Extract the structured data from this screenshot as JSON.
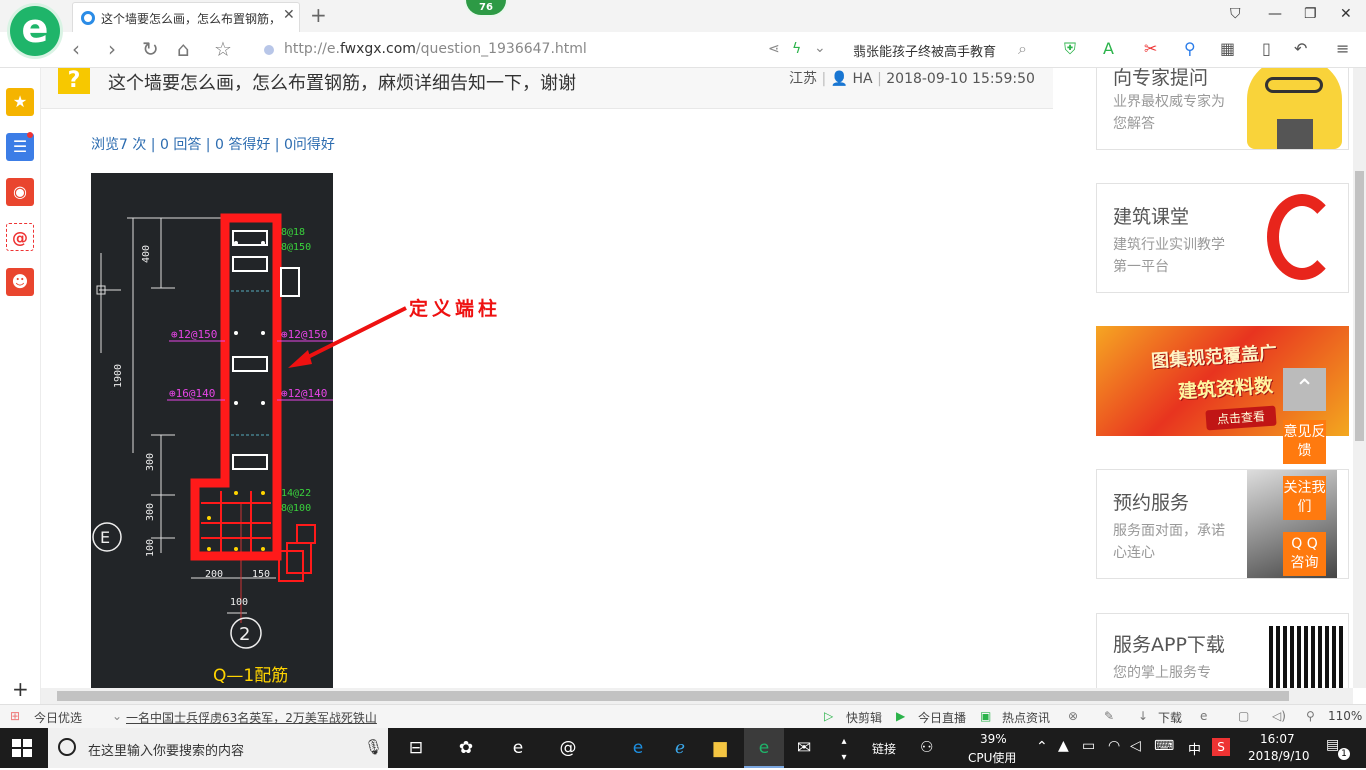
{
  "browser": {
    "tab_title": "这个墙要怎么画，怎么布置钢筋，",
    "badge": "76",
    "url_prefix": "http://e.",
    "url_domain": "fwxgx.com",
    "url_path": "/question_1936647.html",
    "search_text": "翡张能孩子终被高手教育"
  },
  "question": {
    "title": "这个墙要怎么画，怎么布置钢筋，麻烦详细告知一下，谢谢",
    "location": "江苏",
    "user": "HA",
    "datetime": "2018-09-10 15:59:50",
    "stats": {
      "views": "浏览7 次",
      "answers": "0 回答",
      "good_answers": "0 答得好",
      "good_questions": "0问得好"
    },
    "annotation": "定义端柱"
  },
  "cad": {
    "dims_left": [
      "400",
      "1900",
      "300",
      "300",
      "100"
    ],
    "dims_bottom": [
      "200",
      "150",
      "100"
    ],
    "rebar_labels": [
      "8@18",
      "8@150",
      "⊕12@150",
      "⊕12@150",
      "⊕16@140",
      "⊕12@140",
      "14@22",
      "8@100"
    ],
    "axis_e": "E",
    "axis_2": "2",
    "caption": "Q—1配筋"
  },
  "sidebar_right": {
    "expert": {
      "title": "向专家提问",
      "sub": "业界最权威专家为您解答"
    },
    "classroom": {
      "title": "建筑课堂",
      "sub": "建筑行业实训教学第一平台"
    },
    "promo": {
      "line1": "图集规范覆盖广",
      "line2": "建筑资料数",
      "cta": "点击查看"
    },
    "booking": {
      "title": "预约服务",
      "sub": "服务面对面，承诺心连心"
    },
    "app": {
      "title": "服务APP下载",
      "sub": "您的掌上服务专"
    }
  },
  "float_buttons": {
    "feedback": "意见反馈",
    "follow": "关注我们",
    "qq": "Q Q 咨询"
  },
  "statusbar": {
    "today": "今日优选",
    "news": "一名中国士兵俘虏63名英军，2万美军战死铁山",
    "quick_clip": "快剪辑",
    "live": "今日直播",
    "hot": "热点资讯",
    "download": "下载",
    "zoom": "110%"
  },
  "taskbar": {
    "search_placeholder": "在这里输入你要搜索的内容",
    "link": "链接",
    "cpu_value": "39%",
    "cpu_label": "CPU使用",
    "ime": "中",
    "time": "16:07",
    "date": "2018/9/10",
    "notif": "1"
  },
  "colors": {
    "brand_green": "#1fb56a",
    "accent_orange": "#ff7a0f",
    "link_blue": "#2c6cb0",
    "cad_red": "#ff1a1a"
  }
}
